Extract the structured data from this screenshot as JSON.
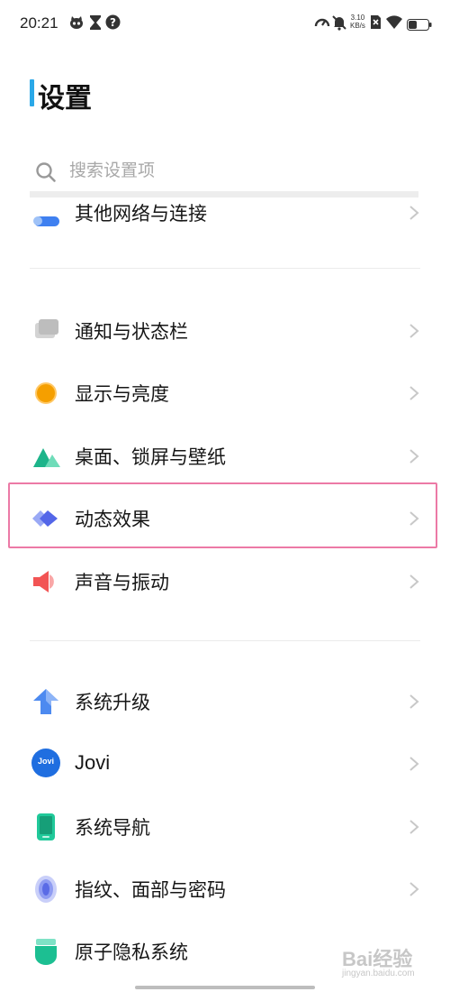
{
  "status_bar": {
    "time": "20:21",
    "net_speed": "3.10",
    "net_unit": "KB/s",
    "icons": [
      "cat-icon",
      "hourglass-icon",
      "help-circle-icon",
      "speedometer-icon",
      "mute-icon",
      "sim-card-icon",
      "wifi-icon",
      "battery-icon"
    ]
  },
  "header": {
    "title": "设置",
    "accent_color": "#2aa8e8"
  },
  "search": {
    "placeholder": "搜索设置项"
  },
  "menu": {
    "items": [
      {
        "label": "其他网络与连接",
        "icon": "network-icon"
      },
      {
        "label": "通知与状态栏",
        "icon": "notification-icon"
      },
      {
        "label": "显示与亮度",
        "icon": "brightness-icon"
      },
      {
        "label": "桌面、锁屏与壁纸",
        "icon": "wallpaper-icon"
      },
      {
        "label": "动态效果",
        "icon": "motion-effects-icon"
      },
      {
        "label": "声音与振动",
        "icon": "speaker-icon"
      },
      {
        "label": "系统升级",
        "icon": "upgrade-arrow-icon"
      },
      {
        "label": "Jovi",
        "icon": "jovi-icon",
        "badge": "Jovi"
      },
      {
        "label": "系统导航",
        "icon": "phone-navigation-icon"
      },
      {
        "label": "指纹、面部与密码",
        "icon": "fingerprint-icon"
      },
      {
        "label": "原子隐私系统",
        "icon": "privacy-shield-icon"
      }
    ]
  },
  "highlight_color": "#ec7aa6",
  "watermark": {
    "text": "Bai经验",
    "sub": "jingyan.baidu.com"
  }
}
